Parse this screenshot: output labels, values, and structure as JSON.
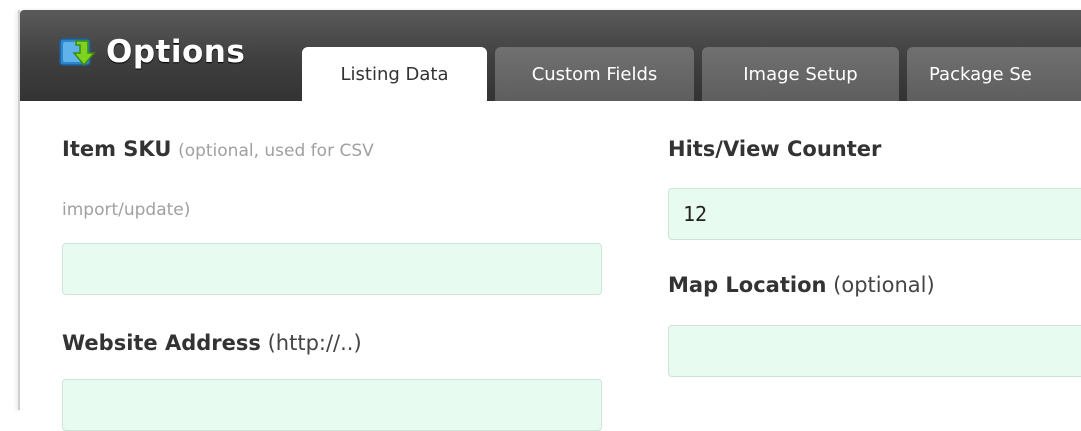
{
  "header": {
    "title": "Options",
    "icon": "folder-download-icon"
  },
  "tabs": [
    {
      "label": "Listing Data",
      "active": true
    },
    {
      "label": "Custom Fields",
      "active": false
    },
    {
      "label": "Image Setup",
      "active": false
    },
    {
      "label": "Package Se",
      "active": false
    }
  ],
  "fields": {
    "item_sku": {
      "label": "Item SKU",
      "hint_line1": "(optional, used for CSV",
      "hint_line2": "import/update)",
      "value": ""
    },
    "website": {
      "label": "Website Address",
      "hint": "(http://..)",
      "value": ""
    },
    "hits": {
      "label": "Hits/View Counter",
      "value": "12"
    },
    "map": {
      "label": "Map Location",
      "hint": "(optional)",
      "value": ""
    }
  },
  "colors": {
    "header_bg": "#3f3f3f",
    "tab_inactive": "#666666",
    "input_bg": "#e8fbf0",
    "hint_text": "#a0a0a0"
  }
}
